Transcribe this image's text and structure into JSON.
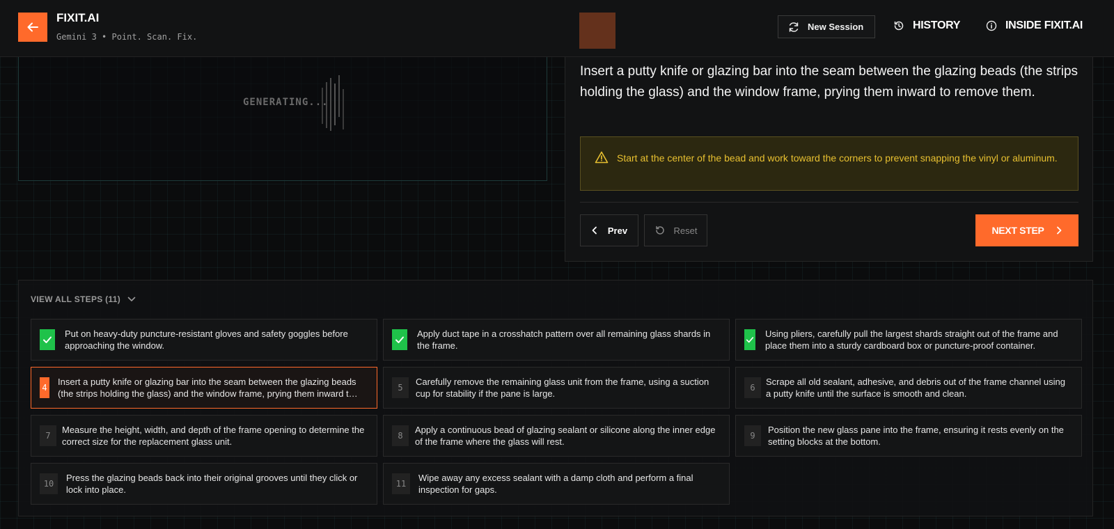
{
  "header": {
    "brand_title": "FIXIT.AI",
    "brand_subtitle": "Gemini 3 • Point. Scan. Fix.",
    "new_session_label": "New Session",
    "history_label": "HISTORY",
    "inside_label": "INSIDE FIXIT.AI"
  },
  "preview": {
    "status_text": "GENERATING..."
  },
  "current_step": {
    "instruction": "Insert a putty knife or glazing bar into the seam between the glazing beads (the strips holding the glass) and the window frame, prying them inward to remove them.",
    "warning": "Start at the center of the bead and work toward the corners to prevent snapping the vinyl or aluminum.",
    "prev_label": "Prev",
    "reset_label": "Reset",
    "next_label": "NEXT STEP"
  },
  "steps_list": {
    "toggle_label": "VIEW ALL STEPS (11)",
    "items": [
      {
        "number": "1",
        "status": "done",
        "text": "Put on heavy-duty puncture-resistant gloves and safety goggles before approaching the window."
      },
      {
        "number": "2",
        "status": "done",
        "text": "Apply duct tape in a crosshatch pattern over all remaining glass shards in the frame."
      },
      {
        "number": "3",
        "status": "done",
        "text": "Using pliers, carefully pull the largest shards straight out of the frame and place them into a sturdy cardboard box or puncture-proof container."
      },
      {
        "number": "4",
        "status": "active",
        "text": "Insert a putty knife or glazing bar into the seam between the glazing beads (the strips holding the glass) and the window frame, prying them inward to remove them."
      },
      {
        "number": "5",
        "status": "pending",
        "text": "Carefully remove the remaining glass unit from the frame, using a suction cup for stability if the pane is large."
      },
      {
        "number": "6",
        "status": "pending",
        "text": "Scrape all old sealant, adhesive, and debris out of the frame channel using a putty knife until the surface is smooth and clean."
      },
      {
        "number": "7",
        "status": "pending",
        "text": "Measure the height, width, and depth of the frame opening to determine the correct size for the replacement glass unit."
      },
      {
        "number": "8",
        "status": "pending",
        "text": "Apply a continuous bead of glazing sealant or silicone along the inner edge of the frame where the glass will rest."
      },
      {
        "number": "9",
        "status": "pending",
        "text": "Position the new glass pane into the frame, ensuring it rests evenly on the setting blocks at the bottom."
      },
      {
        "number": "10",
        "status": "pending",
        "text": "Press the glazing beads back into their original grooves until they click or lock into place."
      },
      {
        "number": "11",
        "status": "pending",
        "text": "Wipe away any excess sealant with a damp cloth and perform a final inspection for gaps."
      }
    ]
  },
  "colors": {
    "accent": "#ff6a2b",
    "done": "#1fc24a",
    "warning_text": "#e8c030"
  },
  "icons": {
    "back": "arrow-left-icon",
    "new_session": "refresh-icon",
    "history": "history-icon",
    "inside": "info-icon",
    "warning": "warning-triangle-icon",
    "prev": "chevron-left-icon",
    "reset": "reset-icon",
    "next": "chevron-right-icon",
    "toggle": "chevron-down-icon",
    "done": "check-icon"
  }
}
